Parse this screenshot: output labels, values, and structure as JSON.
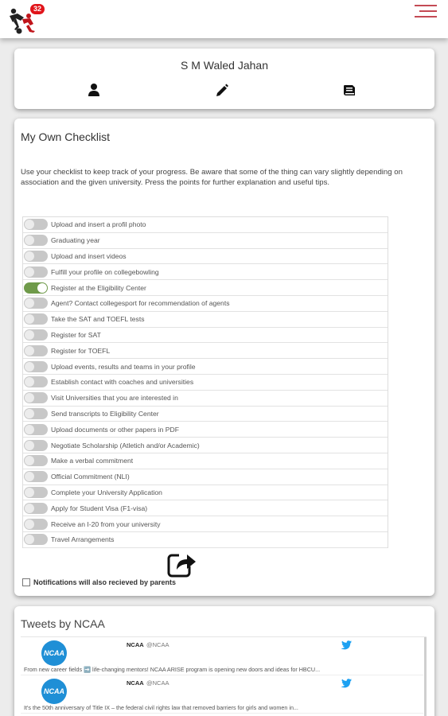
{
  "header": {
    "logo_icon": "wrestlers-logo-icon",
    "notification_count": "32",
    "menu_icon": "hamburger-menu-icon",
    "accent_color": "#c44a54"
  },
  "profile": {
    "name": "S M Waled Jahan",
    "icons": [
      "user-icon",
      "pencil-icon",
      "book-icon"
    ]
  },
  "checklist": {
    "title": "My Own Checklist",
    "description": "Use your checklist to keep track of your progress. Be aware that some of the thing can vary slightly depending on association and the given university. Press the points for further explanation and useful tips.",
    "toggle_on_color": "#6f9a4a",
    "items": [
      {
        "label": "Upload and insert a profil photo",
        "on": false
      },
      {
        "label": "Graduating year",
        "on": false
      },
      {
        "label": "Upload and insert videos",
        "on": false
      },
      {
        "label": "Fulfill your profile on collegebowling",
        "on": false
      },
      {
        "label": "Register at the Eligibility Center",
        "on": true
      },
      {
        "label": "Agent? Contact collegesport for recommendation of agents",
        "on": false
      },
      {
        "label": "Take the SAT and TOEFL tests",
        "on": false
      },
      {
        "label": "Register for SAT",
        "on": false
      },
      {
        "label": "Register for TOEFL",
        "on": false
      },
      {
        "label": "Upload events, results and teams in your profile",
        "on": false
      },
      {
        "label": "Establish contact with coaches and universities",
        "on": false
      },
      {
        "label": "Visit Universities that you are interested in",
        "on": false
      },
      {
        "label": "Send transcripts to Eligibility Center",
        "on": false
      },
      {
        "label": "Upload documents or other papers in PDF",
        "on": false
      },
      {
        "label": "Negotiate Scholarship (Atletich and/or Academic)",
        "on": false
      },
      {
        "label": "Make a verbal commitment",
        "on": false
      },
      {
        "label": "Official Commitment (NLI)",
        "on": false
      },
      {
        "label": "Complete your University Application",
        "on": false
      },
      {
        "label": "Apply for Student Visa (F1-visa)",
        "on": false
      },
      {
        "label": "Receive an I-20 from your university",
        "on": false
      },
      {
        "label": "Travel Arrangements",
        "on": false
      }
    ],
    "share_icon": "share-icon",
    "notification_label": "Notifications will also recieved by parents",
    "notification_checked": false
  },
  "tweets": {
    "title": "Tweets by NCAA",
    "items": [
      {
        "avatar": "NCAA",
        "name": "NCAA",
        "handle": "@NCAA",
        "text": "From new career fields ➡️ life-changing mentors! NCAA ARISE program is opening new doors and ideas for HBCU..."
      },
      {
        "avatar": "NCAA",
        "name": "NCAA",
        "handle": "@NCAA",
        "text": "It's the 50th anniversary of Title IX – the federal civil rights law that removed barriers for girls and women in..."
      }
    ]
  }
}
